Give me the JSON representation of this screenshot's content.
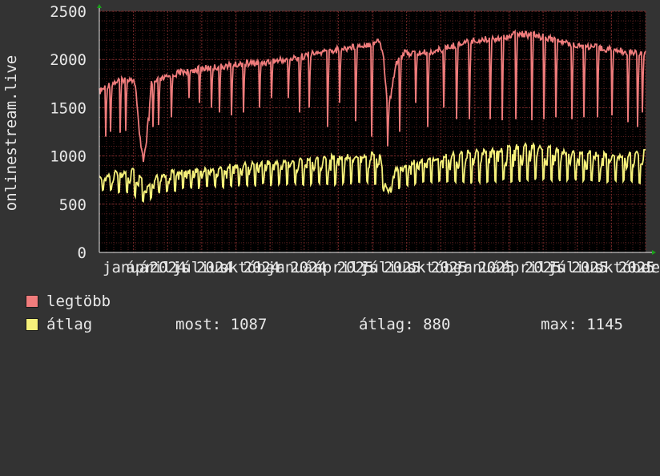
{
  "chart_data": {
    "type": "line",
    "ylabel": "onlinestream.live",
    "ylim": [
      0,
      2500
    ],
    "yticks": [
      0,
      500,
      1000,
      1500,
      2000,
      2500
    ],
    "xticks": [
      "január",
      "április",
      "2024",
      "július",
      "2024",
      "október",
      "2024",
      "január",
      "2024",
      "április",
      "2025",
      "július",
      "2025",
      "október",
      "2025",
      "január",
      "2025",
      "április",
      "2025",
      "július",
      "2025",
      "október",
      "2025",
      "december"
    ],
    "grid": true,
    "background": "#000000",
    "series": [
      {
        "name": "legtöbb",
        "color": "#f07c7c",
        "envelope": [
          [
            0,
            1700
          ],
          [
            10,
            1760
          ],
          [
            20,
            1800
          ],
          [
            30,
            1830
          ],
          [
            40,
            1840
          ],
          [
            45,
            1780
          ],
          [
            50,
            1250
          ],
          [
            55,
            1000
          ],
          [
            60,
            1200
          ],
          [
            65,
            1780
          ],
          [
            75,
            1820
          ],
          [
            85,
            1850
          ],
          [
            100,
            1900
          ],
          [
            120,
            1930
          ],
          [
            140,
            1950
          ],
          [
            160,
            1970
          ],
          [
            180,
            1990
          ],
          [
            200,
            2000
          ],
          [
            220,
            2020
          ],
          [
            240,
            2040
          ],
          [
            260,
            2080
          ],
          [
            280,
            2110
          ],
          [
            300,
            2140
          ],
          [
            320,
            2170
          ],
          [
            340,
            2200
          ],
          [
            350,
            2230
          ],
          [
            355,
            2050
          ],
          [
            360,
            1500
          ],
          [
            365,
            1700
          ],
          [
            370,
            2000
          ],
          [
            380,
            2100
          ],
          [
            400,
            2100
          ],
          [
            420,
            2120
          ],
          [
            440,
            2170
          ],
          [
            460,
            2220
          ],
          [
            480,
            2240
          ],
          [
            500,
            2260
          ],
          [
            520,
            2300
          ],
          [
            540,
            2290
          ],
          [
            560,
            2260
          ],
          [
            580,
            2210
          ],
          [
            600,
            2180
          ],
          [
            620,
            2160
          ],
          [
            640,
            2140
          ],
          [
            660,
            2110
          ],
          [
            682,
            2100
          ]
        ],
        "dips": [
          [
            8,
            1200
          ],
          [
            14,
            1250
          ],
          [
            26,
            1240
          ],
          [
            33,
            1260
          ],
          [
            60,
            1300
          ],
          [
            67,
            1300
          ],
          [
            74,
            1320
          ],
          [
            90,
            1400
          ],
          [
            112,
            1600
          ],
          [
            125,
            1550
          ],
          [
            140,
            1500
          ],
          [
            150,
            1450
          ],
          [
            165,
            1420
          ],
          [
            180,
            1450
          ],
          [
            200,
            1500
          ],
          [
            215,
            1600
          ],
          [
            236,
            1600
          ],
          [
            250,
            1450
          ],
          [
            262,
            1500
          ],
          [
            285,
            1300
          ],
          [
            300,
            1550
          ],
          [
            320,
            1360
          ],
          [
            340,
            1200
          ],
          [
            360,
            1100
          ],
          [
            375,
            1250
          ],
          [
            395,
            1550
          ],
          [
            410,
            1300
          ],
          [
            430,
            1500
          ],
          [
            446,
            1380
          ],
          [
            462,
            1380
          ],
          [
            488,
            1380
          ],
          [
            503,
            1370
          ],
          [
            520,
            1380
          ],
          [
            540,
            1370
          ],
          [
            555,
            1380
          ],
          [
            570,
            1400
          ],
          [
            590,
            1380
          ],
          [
            605,
            1400
          ],
          [
            622,
            1400
          ],
          [
            640,
            1420
          ],
          [
            660,
            1350
          ],
          [
            672,
            1300
          ],
          [
            678,
            1450
          ]
        ],
        "min": 900,
        "max": 2330
      },
      {
        "name": "átlag",
        "color": "#f5f07a",
        "envelope": [
          [
            0,
            800
          ],
          [
            25,
            860
          ],
          [
            45,
            880
          ],
          [
            55,
            750
          ],
          [
            60,
            700
          ],
          [
            70,
            800
          ],
          [
            90,
            860
          ],
          [
            120,
            880
          ],
          [
            150,
            900
          ],
          [
            180,
            940
          ],
          [
            210,
            960
          ],
          [
            240,
            980
          ],
          [
            270,
            1000
          ],
          [
            300,
            1020
          ],
          [
            330,
            1040
          ],
          [
            350,
            1060
          ],
          [
            355,
            800
          ],
          [
            360,
            650
          ],
          [
            370,
            900
          ],
          [
            390,
            960
          ],
          [
            410,
            1000
          ],
          [
            430,
            1030
          ],
          [
            450,
            1050
          ],
          [
            470,
            1080
          ],
          [
            500,
            1100
          ],
          [
            530,
            1130
          ],
          [
            545,
            1140
          ],
          [
            560,
            1110
          ],
          [
            580,
            1080
          ],
          [
            600,
            1060
          ],
          [
            620,
            1050
          ],
          [
            640,
            1040
          ],
          [
            660,
            1040
          ],
          [
            682,
            1087
          ]
        ],
        "lows": [
          [
            0,
            640
          ],
          [
            25,
            620
          ],
          [
            50,
            560
          ],
          [
            58,
            490
          ],
          [
            70,
            600
          ],
          [
            100,
            640
          ],
          [
            150,
            660
          ],
          [
            200,
            680
          ],
          [
            250,
            690
          ],
          [
            300,
            700
          ],
          [
            350,
            700
          ],
          [
            358,
            580
          ],
          [
            365,
            620
          ],
          [
            400,
            700
          ],
          [
            450,
            710
          ],
          [
            500,
            720
          ],
          [
            550,
            740
          ],
          [
            600,
            730
          ],
          [
            650,
            720
          ],
          [
            682,
            700
          ]
        ],
        "stats": {
          "most": 1087,
          "atlag": 880,
          "max": 1145
        }
      }
    ]
  },
  "legend": {
    "series1_label": "legtöbb",
    "series2_label": "átlag",
    "most_text": "most: 1087",
    "atlag_text": "átlag: 880",
    "max_text": "max: 1145"
  }
}
